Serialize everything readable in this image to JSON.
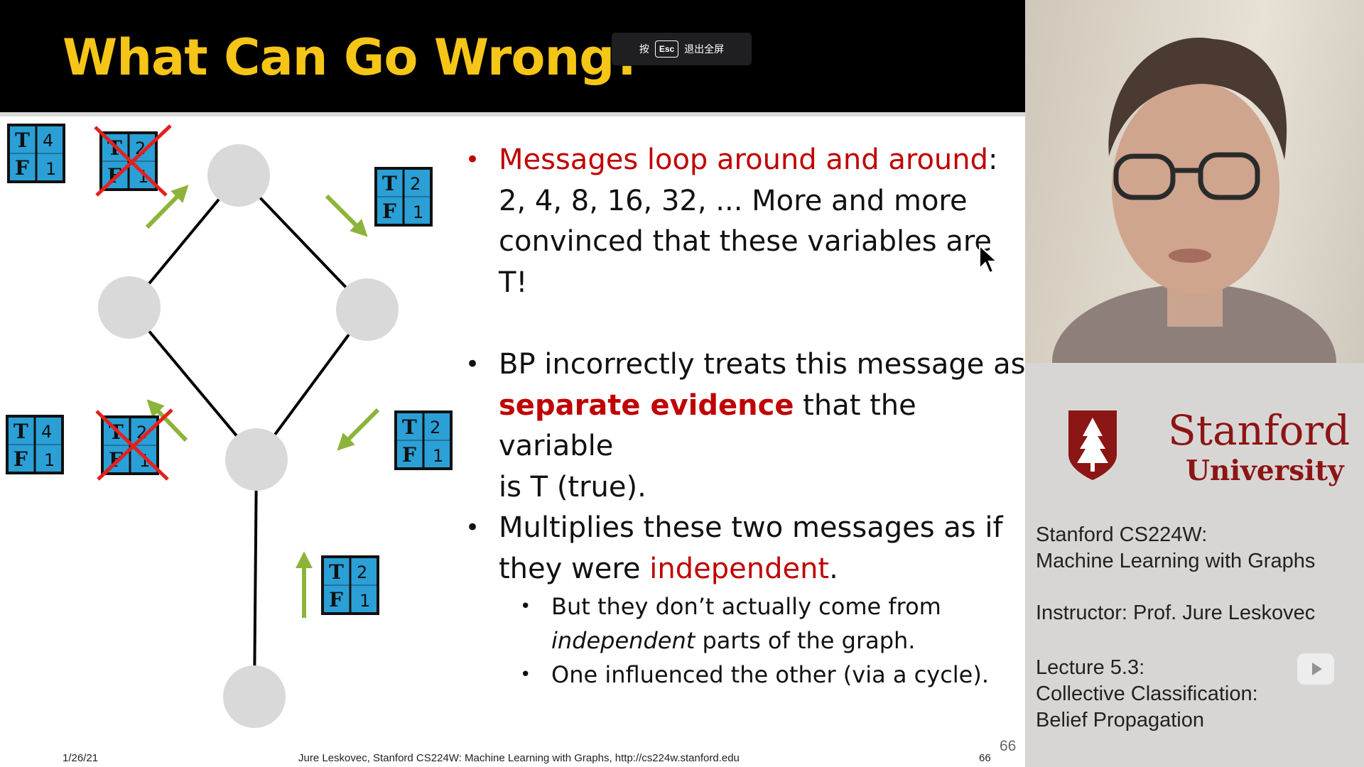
{
  "slide": {
    "title": "What Can Go Wrong?",
    "esc_hint": {
      "prefix": "按",
      "key": "Esc",
      "suffix": "退出全屏"
    },
    "tf_boxes": [
      {
        "t": "T",
        "f": "F",
        "t_val": "4",
        "f_val": "1",
        "crossed": false
      },
      {
        "t": "T",
        "f": "F",
        "t_val": "2",
        "f_val": "1",
        "crossed": true
      },
      {
        "t": "T",
        "f": "F",
        "t_val": "2",
        "f_val": "1",
        "crossed": false
      },
      {
        "t": "T",
        "f": "F",
        "t_val": "4",
        "f_val": "1",
        "crossed": false
      },
      {
        "t": "T",
        "f": "F",
        "t_val": "2",
        "f_val": "1",
        "crossed": true
      },
      {
        "t": "T",
        "f": "F",
        "t_val": "2",
        "f_val": "1",
        "crossed": false
      },
      {
        "t": "T",
        "f": "F",
        "t_val": "2",
        "f_val": "1",
        "crossed": false
      }
    ],
    "bullets": {
      "b1": {
        "red": "Messages loop around and around",
        "rest1": ":",
        "line2": "2, 4, 8, 16, 32, ... More and more",
        "line3": "convinced that these variables are T!"
      },
      "b2": {
        "line1": "BP incorrectly treats this message as",
        "red_bold": "separate evidence",
        "rest2": " that the variable",
        "line3": "is T (true)."
      },
      "b3": {
        "line1": "Multiplies these two messages as if",
        "line2a": "they were ",
        "red": "independent",
        "line2b": "."
      },
      "b3_sub1": {
        "line1": "But they don’t actually come from",
        "italic": "independent",
        "rest": " parts of the graph."
      },
      "b3_sub2": {
        "text": "One influenced the other (via a cycle)."
      }
    },
    "footer": {
      "date": "1/26/21",
      "center": "Jure Leskovec, Stanford CS224W: Machine Learning with Graphs, http://cs224w.stanford.edu",
      "num": "66",
      "big_num": "66"
    },
    "colors": {
      "title": "#f5c518",
      "red": "#c00000",
      "box": "#2aa0d6",
      "arrow": "#8db33a",
      "node": "#d9d9d9"
    }
  },
  "panel": {
    "logo": {
      "word1": "Stanford",
      "word2": "University"
    },
    "course_line1": "Stanford CS224W:",
    "course_line2": "Machine Learning with Graphs",
    "instructor": "Instructor: Prof. Jure Leskovec",
    "lecture_line1": "Lecture 5.3:",
    "lecture_line2": "Collective Classification:",
    "lecture_line3": "Belief Propagation",
    "colors": {
      "stanford_red": "#8c1515"
    }
  }
}
